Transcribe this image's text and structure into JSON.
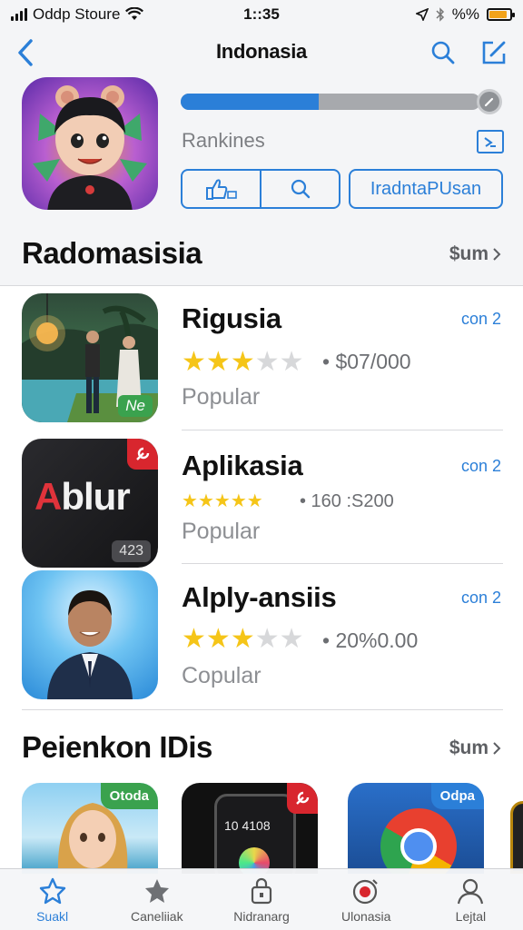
{
  "status_bar": {
    "carrier": "Oddp Stoure",
    "time": "1::35",
    "battery_text": "%%",
    "battery_level": 0.85
  },
  "nav": {
    "title": "Indonasia"
  },
  "hero": {
    "progress": 0.46,
    "rank_label": "Rankines",
    "action_button": "IradntaPUsan"
  },
  "section1": {
    "title": "Radomasisia",
    "see_all": "$um"
  },
  "apps": [
    {
      "name": "Rigusia",
      "get": "con 2",
      "rating": 3,
      "price": "• $07/000",
      "category": "Popular",
      "thumb_badge": "Ne"
    },
    {
      "name": "Aplikasia",
      "get": "con 2",
      "rating": 5,
      "price": "• 160 :S200",
      "category": "Popular",
      "thumb_text": "Ablur",
      "thumb_badge": "423"
    },
    {
      "name": "Alply-ansiis",
      "get": "con 2",
      "rating": 3,
      "price": "• 20%0.00",
      "category": "Copular"
    }
  ],
  "section2": {
    "title": "Peienkon IDis",
    "see_all": "$um"
  },
  "features": [
    {
      "tag": "Otoda"
    },
    {
      "tag": "",
      "screen_text": "10 4108"
    },
    {
      "tag": "Odpa"
    }
  ],
  "tabs": [
    {
      "label": "Suakl",
      "icon": "star-outline-icon"
    },
    {
      "label": "Caneliiak",
      "icon": "star-filled-icon"
    },
    {
      "label": "Nidranarg",
      "icon": "lock-bag-icon"
    },
    {
      "label": "Ulonasia",
      "icon": "record-icon"
    },
    {
      "label": "Lejtal",
      "icon": "person-icon"
    }
  ],
  "colors": {
    "accent": "#2b7fd8",
    "star": "#f5c518",
    "battery": "#f2a31b"
  }
}
